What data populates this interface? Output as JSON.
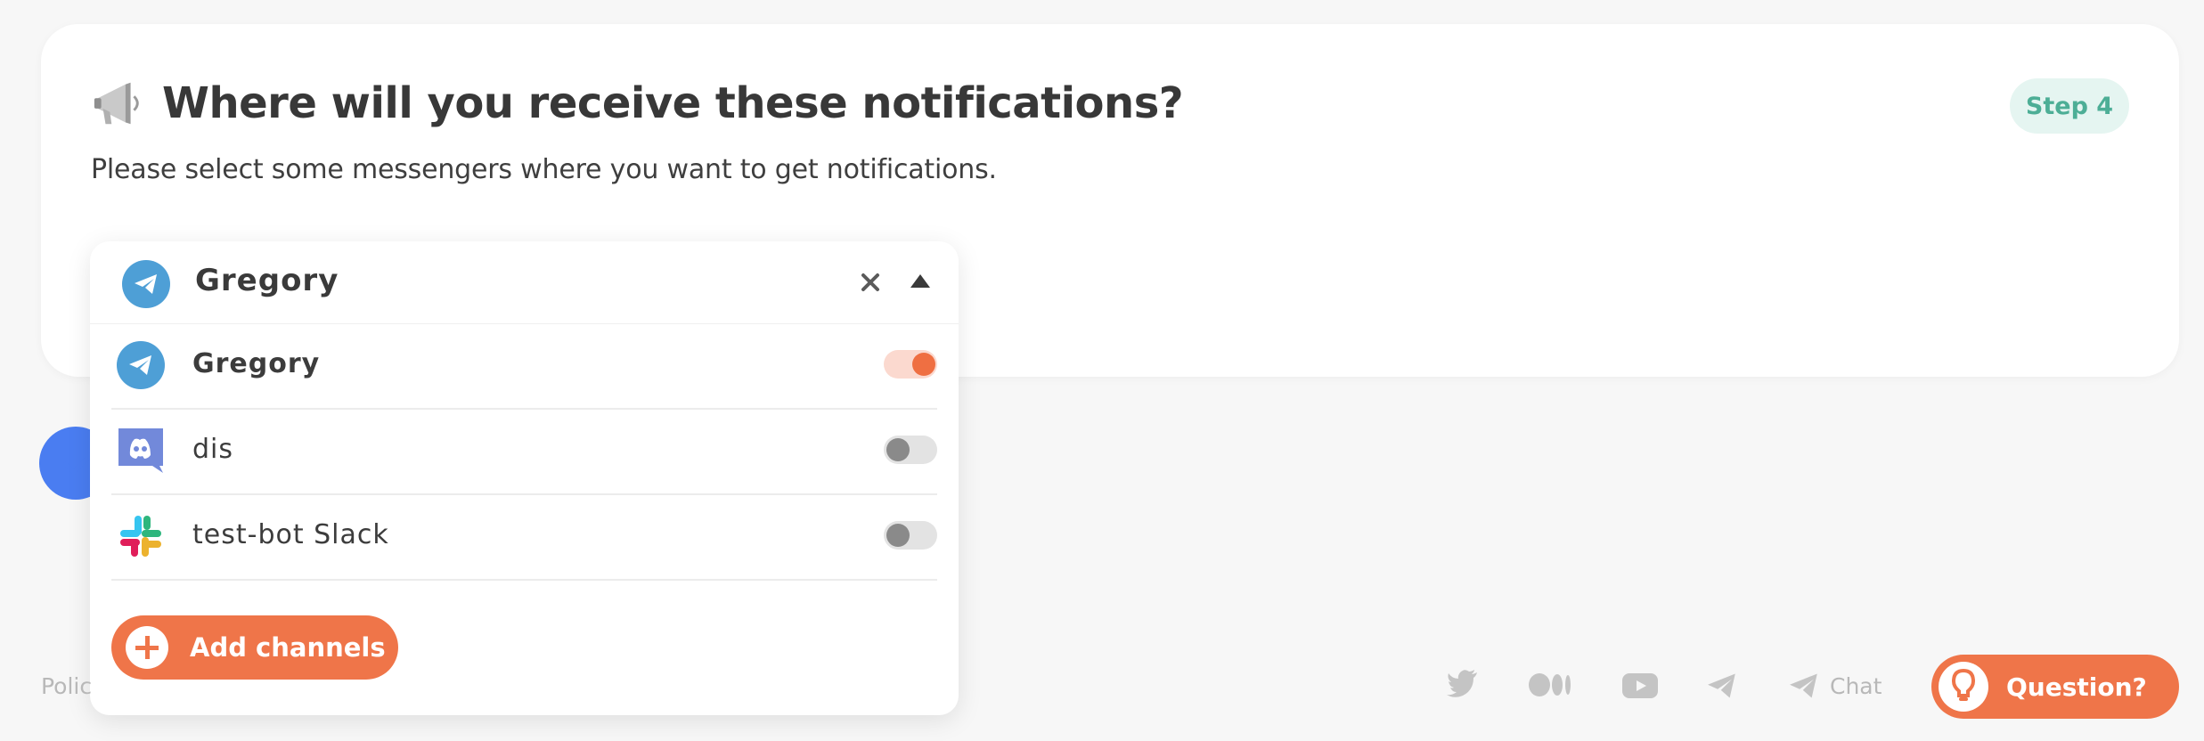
{
  "header": {
    "title": "Where will you receive these notifications?",
    "subtitle": "Please select some messengers where you want to get notifications.",
    "step": "Step 4"
  },
  "dropdown": {
    "selected_label": "Gregory",
    "items": [
      {
        "label": "Gregory",
        "icon": "telegram-icon",
        "enabled": true
      },
      {
        "label": "dis",
        "icon": "discord-icon",
        "enabled": false
      },
      {
        "label": "test-bot Slack",
        "icon": "slack-icon",
        "enabled": false
      }
    ],
    "add_button": "Add channels"
  },
  "footer": {
    "left_text": "Polic",
    "chat_label": "Chat",
    "question_button": "Question?",
    "social_icons": [
      "twitter-icon",
      "medium-icon",
      "youtube-icon",
      "telegram-icon",
      "chat-icon"
    ]
  },
  "colors": {
    "accent": "#ef7549",
    "step_bg": "#e5f5f1",
    "step_text": "#4dae96",
    "telegram": "#4e9fd6",
    "discord": "#7289da",
    "check_blue": "#4a7df1"
  }
}
